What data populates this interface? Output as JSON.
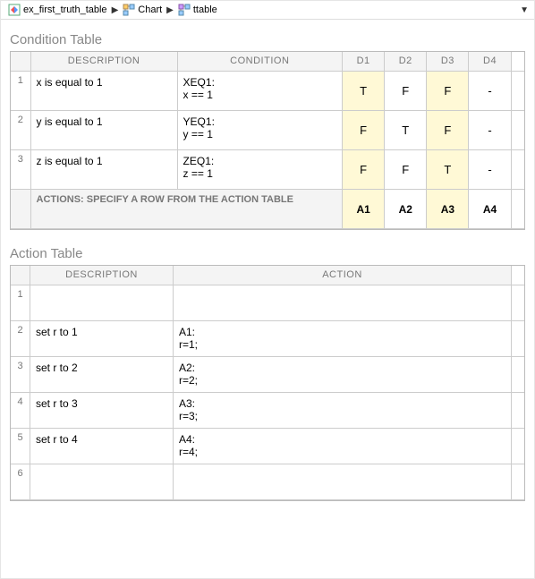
{
  "breadcrumb": {
    "items": [
      {
        "label": "ex_first_truth_table",
        "icon": "model-icon"
      },
      {
        "label": "Chart",
        "icon": "chart-icon"
      },
      {
        "label": "ttable",
        "icon": "ttable-icon"
      }
    ]
  },
  "condition_table": {
    "title": "Condition Table",
    "headers": {
      "desc": "DESCRIPTION",
      "cond": "CONDITION",
      "d": [
        "D1",
        "D2",
        "D3",
        "D4"
      ]
    },
    "rows": [
      {
        "num": "1",
        "desc": "x is equal to 1",
        "cond": "XEQ1:\nx == 1",
        "d": [
          "T",
          "F",
          "F",
          "-"
        ],
        "hl": [
          true,
          false,
          true,
          false
        ]
      },
      {
        "num": "2",
        "desc": "y is equal to 1",
        "cond": "YEQ1:\ny == 1",
        "d": [
          "F",
          "T",
          "F",
          "-"
        ],
        "hl": [
          true,
          false,
          true,
          false
        ]
      },
      {
        "num": "3",
        "desc": "z is equal to 1",
        "cond": "ZEQ1:\nz == 1",
        "d": [
          "F",
          "F",
          "T",
          "-"
        ],
        "hl": [
          true,
          false,
          true,
          false
        ]
      }
    ],
    "actions_label": "ACTIONS: SPECIFY A ROW FROM THE ACTION TABLE",
    "actions": {
      "d": [
        "A1",
        "A2",
        "A3",
        "A4"
      ],
      "hl": [
        true,
        false,
        true,
        false
      ]
    }
  },
  "action_table": {
    "title": "Action Table",
    "headers": {
      "desc": "DESCRIPTION",
      "act": "ACTION"
    },
    "rows": [
      {
        "num": "1",
        "desc": "",
        "act": ""
      },
      {
        "num": "2",
        "desc": "set r to 1",
        "act": "A1:\nr=1;"
      },
      {
        "num": "3",
        "desc": "set r to 2",
        "act": "A2:\nr=2;"
      },
      {
        "num": "4",
        "desc": "set r to 3",
        "act": "A3:\nr=3;"
      },
      {
        "num": "5",
        "desc": "set r to 4",
        "act": "A4:\nr=4;"
      },
      {
        "num": "6",
        "desc": "",
        "act": ""
      }
    ]
  }
}
